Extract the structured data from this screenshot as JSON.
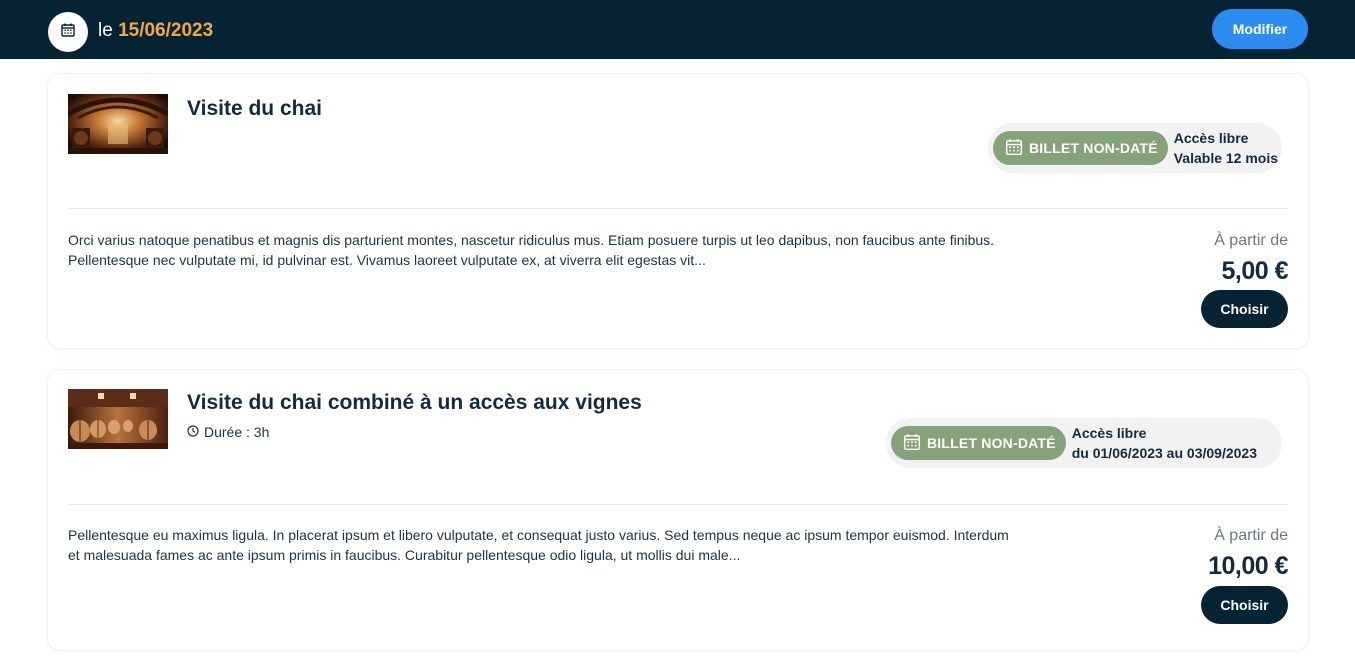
{
  "header": {
    "date_prefix": "le",
    "date_value": "15/06/2023",
    "modify_label": "Modifier"
  },
  "offers": [
    {
      "title": "Visite du chai",
      "badge_label": "BILLET NON-DATÉ",
      "access_line1": "Accès libre",
      "access_line2": "Valable 12 mois",
      "description_line1": "Orci varius natoque penatibus et magnis dis parturient montes, nascetur ridiculus mus. Etiam posuere turpis ut leo dapibus, non faucibus ante finibus.",
      "description_line2": "Pellentesque nec vulputate mi, id pulvinar est. Vivamus laoreet vulputate ex, at viverra elit egestas vit...",
      "price_from": "À partir de",
      "price": "5,00 €",
      "choose_label": "Choisir"
    },
    {
      "title": "Visite du chai combiné à un accès aux vignes",
      "duration": "Durée : 3h",
      "badge_label": "BILLET NON-DATÉ",
      "access_line1": "Accès libre",
      "access_line2": "du 01/06/2023 au 03/09/2023",
      "description_line1": "Pellentesque eu maximus ligula. In placerat ipsum et libero vulputate, et consequat justo varius. Sed tempus neque ac ipsum tempor euismod. Interdum",
      "description_line2": "et malesuada fames ac ante ipsum primis in faucibus. Curabitur pellentesque odio ligula, ut mollis dui male...",
      "price_from": "À partir de",
      "price": "10,00 €",
      "choose_label": "Choisir"
    }
  ],
  "icons": {
    "header_calendar": "calendar-icon",
    "badge_calendar": "calendar-icon",
    "duration": "clock-icon"
  },
  "colors": {
    "header_bg": "#062333",
    "date_accent": "#f5a742",
    "modify_button": "#2d8cf0",
    "badge_green": "#85a37a",
    "choose_button": "#062333"
  }
}
